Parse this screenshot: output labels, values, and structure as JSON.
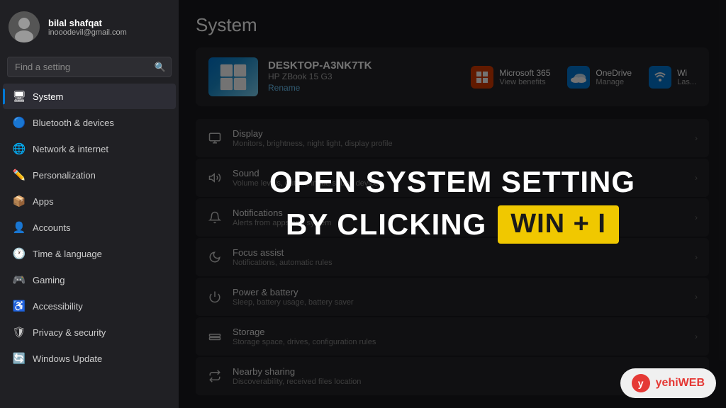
{
  "sidebar": {
    "user": {
      "name": "bilal shafqat",
      "email": "inooodevil@gmail.com"
    },
    "search_placeholder": "Find a setting",
    "nav_items": [
      {
        "id": "system",
        "label": "System",
        "icon": "🖥",
        "active": true
      },
      {
        "id": "bluetooth",
        "label": "Bluetooth & devices",
        "icon": "🔵",
        "active": false
      },
      {
        "id": "network",
        "label": "Network & internet",
        "icon": "🌐",
        "active": false
      },
      {
        "id": "personalization",
        "label": "Personalization",
        "icon": "✏️",
        "active": false
      },
      {
        "id": "apps",
        "label": "Apps",
        "icon": "📦",
        "active": false
      },
      {
        "id": "accounts",
        "label": "Accounts",
        "icon": "👤",
        "active": false
      },
      {
        "id": "time",
        "label": "Time & language",
        "icon": "🕐",
        "active": false
      },
      {
        "id": "gaming",
        "label": "Gaming",
        "icon": "🎮",
        "active": false
      },
      {
        "id": "accessibility",
        "label": "Accessibility",
        "icon": "♿",
        "active": false
      },
      {
        "id": "privacy",
        "label": "Privacy & security",
        "icon": "🛡",
        "active": false
      },
      {
        "id": "update",
        "label": "Windows Update",
        "icon": "🔄",
        "active": false
      }
    ]
  },
  "main": {
    "title": "System",
    "device": {
      "name": "DESKTOP-A3NK7TK",
      "model": "HP ZBook 15 G3",
      "rename_label": "Rename"
    },
    "app_shortcuts": [
      {
        "id": "ms365",
        "title": "Microsoft 365",
        "sub": "View benefits"
      },
      {
        "id": "onedrive",
        "title": "OneDrive",
        "sub": "Manage"
      },
      {
        "id": "wi",
        "title": "Wi",
        "sub": "Las..."
      }
    ],
    "settings": [
      {
        "id": "display",
        "icon": "🖥",
        "title": "Display",
        "desc": "Monitors, brightness, night light, display profile"
      },
      {
        "id": "sound",
        "icon": "🔊",
        "title": "Sound",
        "desc": "Volume levels, output, input, sound devices"
      },
      {
        "id": "notifications",
        "icon": "🔔",
        "title": "Notifications",
        "desc": "Alerts from apps and system"
      },
      {
        "id": "focus",
        "icon": "🌙",
        "title": "Focus assist",
        "desc": "Notifications, automatic rules"
      },
      {
        "id": "power",
        "icon": "⏻",
        "title": "Power & battery",
        "desc": "Sleep, battery usage, battery saver"
      },
      {
        "id": "storage",
        "icon": "💾",
        "title": "Storage",
        "desc": "Storage space, drives, configuration rules"
      },
      {
        "id": "nearby",
        "icon": "📡",
        "title": "Nearby sharing",
        "desc": "Discoverability, received files location"
      }
    ]
  },
  "overlay": {
    "line1": "OPEN SYSTEM SETTING",
    "line2_prefix": "BY CLICKING",
    "shortcut": "WIN + I"
  },
  "brand": {
    "icon_text": "y",
    "text_plain": "yehi",
    "text_accent": "WEB"
  }
}
